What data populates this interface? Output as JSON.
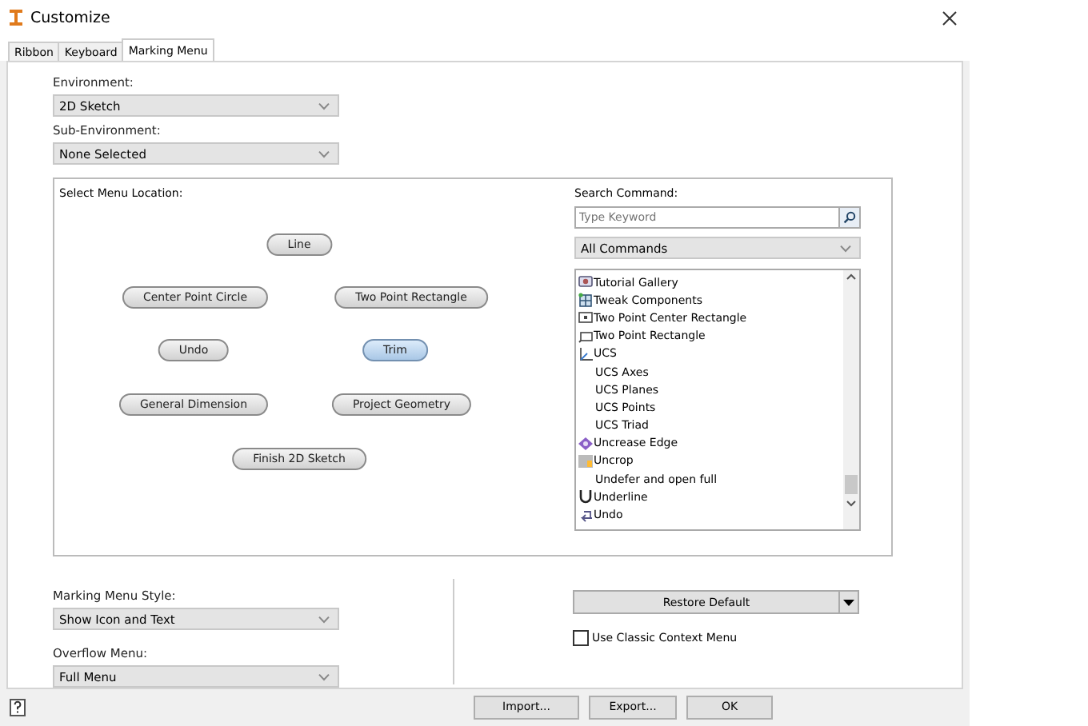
{
  "window": {
    "title": "Customize"
  },
  "tabs": [
    {
      "label": "Ribbon",
      "selected": false
    },
    {
      "label": "Keyboard",
      "selected": false
    },
    {
      "label": "Marking Menu",
      "selected": true
    }
  ],
  "environment": {
    "label": "Environment:",
    "value": "2D Sketch"
  },
  "sub_environment": {
    "label": "Sub-Environment:",
    "value": "None Selected"
  },
  "menu_location": {
    "label": "Select Menu Location:",
    "items": [
      {
        "label": "Line",
        "selected": false
      },
      {
        "label": "Center Point Circle",
        "selected": false
      },
      {
        "label": "Two Point Rectangle",
        "selected": false
      },
      {
        "label": "Undo",
        "selected": false
      },
      {
        "label": "Trim",
        "selected": true
      },
      {
        "label": "General Dimension",
        "selected": false
      },
      {
        "label": "Project Geometry",
        "selected": false
      },
      {
        "label": "Finish 2D Sketch",
        "selected": false
      }
    ]
  },
  "search_command": {
    "label": "Search Command:",
    "placeholder": "Type Keyword",
    "filter": "All Commands",
    "commands": [
      {
        "label": "Tutorial Gallery",
        "kind": "icon"
      },
      {
        "label": "Tweak Components",
        "kind": "icon"
      },
      {
        "label": "Two Point Center Rectangle",
        "kind": "icon"
      },
      {
        "label": "Two Point Rectangle",
        "kind": "icon"
      },
      {
        "label": "UCS",
        "kind": "icon"
      },
      {
        "label": "UCS Axes",
        "kind": "plain"
      },
      {
        "label": "UCS Planes",
        "kind": "plain"
      },
      {
        "label": "UCS Points",
        "kind": "plain"
      },
      {
        "label": "UCS Triad",
        "kind": "plain"
      },
      {
        "label": "Uncrease Edge",
        "kind": "icon"
      },
      {
        "label": "Uncrop",
        "kind": "icon"
      },
      {
        "label": "Undefer and open full",
        "kind": "plain"
      },
      {
        "label": "Underline",
        "kind": "icon"
      },
      {
        "label": "Undo",
        "kind": "icon"
      }
    ]
  },
  "marking_menu_style": {
    "label": "Marking Menu Style:",
    "value": "Show Icon and Text"
  },
  "overflow_menu": {
    "label": "Overflow Menu:",
    "value": "Full Menu"
  },
  "restore_default": {
    "label": "Restore Default"
  },
  "classic_context_menu": {
    "label": "Use Classic Context Menu",
    "checked": false
  },
  "buttons": [
    {
      "label": "Import..."
    },
    {
      "label": "Export..."
    },
    {
      "label": "OK"
    }
  ]
}
